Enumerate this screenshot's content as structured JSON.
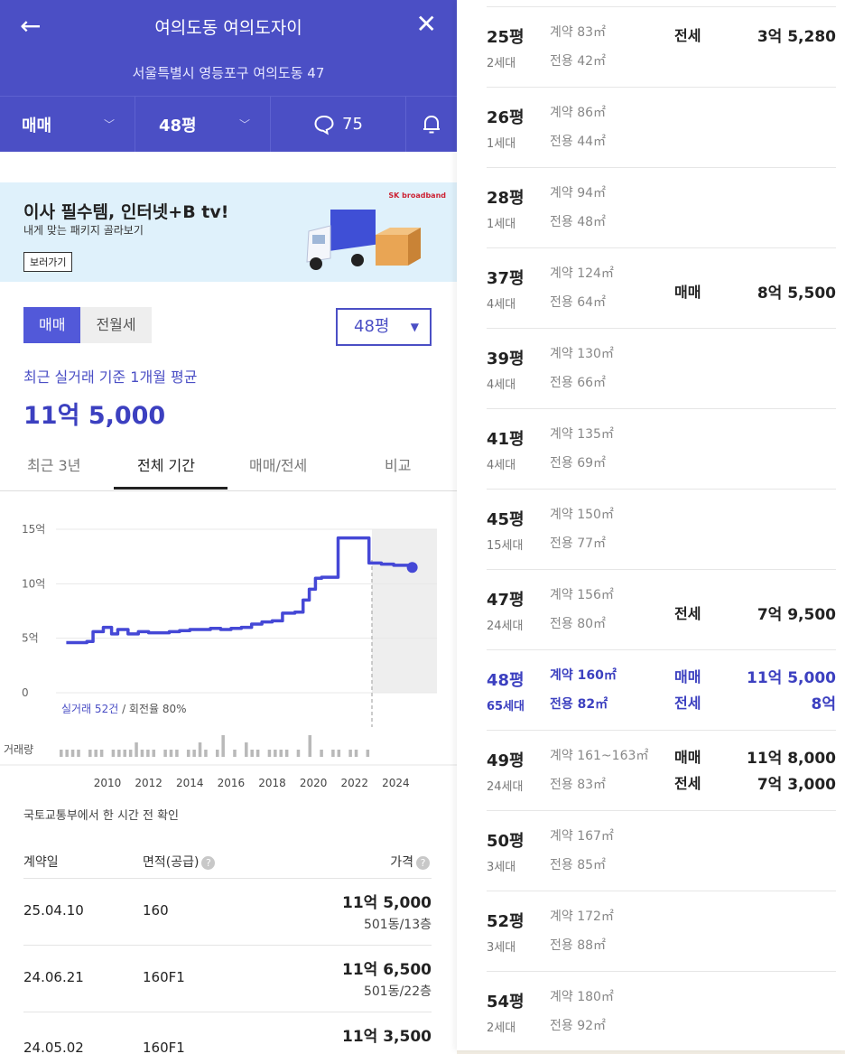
{
  "header": {
    "title": "여의도동 여의도자이",
    "address": "서울특별시 영등포구 여의도동 47",
    "deal_type": "매매",
    "size": "48평",
    "comment_count": "75"
  },
  "ad": {
    "headline": "이사 필수템, 인터넷+B tv!",
    "sub": "내게 맞는 패키지 골라보기",
    "button": "보러가기",
    "brand": "SK broadband"
  },
  "filters": {
    "seg": [
      "매매",
      "전월세"
    ],
    "size_select": "48평"
  },
  "average": {
    "label": "최근 실거래 기준 1개월 평균",
    "value": "11억 5,000"
  },
  "tabs": [
    "최근 3년",
    "전체 기간",
    "매매/전세",
    "비교"
  ],
  "chart_data": {
    "type": "line",
    "y_ticks": [
      "15억",
      "10억",
      "5억",
      "0"
    ],
    "ylim": [
      0,
      15
    ],
    "x_ticks": [
      "2010",
      "2012",
      "2014",
      "2016",
      "2018",
      "2020",
      "2022",
      "2024"
    ],
    "xlim": [
      2008,
      2026.5
    ],
    "series": [
      {
        "x": [
          2008.5,
          2009.5,
          2009.8,
          2010.3,
          2010.7,
          2011.0,
          2011.5,
          2012.0,
          2012.5,
          2013.0,
          2013.5,
          2014.0,
          2014.5,
          2015.0,
          2015.5,
          2016.0,
          2016.5,
          2017.0,
          2017.5,
          2018.0,
          2018.5,
          2019.0,
          2019.6,
          2020.0,
          2020.3,
          2020.6,
          2020.9,
          2021.2,
          2021.7,
          2022.1,
          2022.6,
          2023.2,
          2023.8,
          2024.4,
          2025.3
        ],
        "values": [
          4.6,
          4.7,
          5.6,
          6.0,
          5.4,
          5.8,
          5.4,
          5.6,
          5.5,
          5.5,
          5.6,
          5.7,
          5.8,
          5.8,
          5.9,
          5.8,
          5.9,
          6.0,
          6.3,
          6.5,
          6.6,
          7.3,
          7.4,
          8.5,
          9.5,
          10.5,
          10.6,
          10.6,
          14.2,
          14.2,
          14.2,
          11.9,
          11.8,
          11.7,
          11.5
        ]
      }
    ],
    "volume_label": "거래량",
    "volume": [
      1,
      1,
      1,
      1,
      0,
      1,
      1,
      1,
      0,
      1,
      1,
      1,
      1,
      2,
      1,
      1,
      1,
      0,
      1,
      1,
      1,
      0,
      1,
      1,
      2,
      1,
      0,
      1,
      3,
      0,
      1,
      0,
      2,
      1,
      1,
      0,
      1,
      1,
      1,
      1,
      0,
      1,
      0,
      3,
      0,
      1,
      0,
      1,
      1,
      0,
      1,
      1,
      0,
      1
    ],
    "caption_link": "실거래 52건",
    "caption_rest": " / 회전율 80%"
  },
  "source_note": "국토교통부에서 한 시간 전 확인",
  "table": {
    "headers": [
      "계약일",
      "면적(공급)",
      "가격"
    ],
    "rows": [
      {
        "date": "25.04.10",
        "area": "160",
        "price": "11억 5,000",
        "floor": "501동/13층"
      },
      {
        "date": "24.06.21",
        "area": "160F1",
        "price": "11억 6,500",
        "floor": "501동/22층"
      },
      {
        "date": "24.05.02",
        "area": "160F1",
        "price": "11억 3,500",
        "floor": ""
      }
    ]
  },
  "sizes": [
    {
      "py": "25평",
      "hh": "2세대",
      "contract": "계약 83㎡",
      "exclusive": "전용 42㎡",
      "k1": "전세",
      "v1": "3억 5,280",
      "k2": "",
      "v2": ""
    },
    {
      "py": "26평",
      "hh": "1세대",
      "contract": "계약 86㎡",
      "exclusive": "전용 44㎡",
      "k1": "",
      "v1": "",
      "k2": "",
      "v2": ""
    },
    {
      "py": "28평",
      "hh": "1세대",
      "contract": "계약 94㎡",
      "exclusive": "전용 48㎡",
      "k1": "",
      "v1": "",
      "k2": "",
      "v2": ""
    },
    {
      "py": "37평",
      "hh": "4세대",
      "contract": "계약 124㎡",
      "exclusive": "전용 64㎡",
      "k1": "매매",
      "v1": "8억 5,500",
      "k2": "",
      "v2": ""
    },
    {
      "py": "39평",
      "hh": "4세대",
      "contract": "계약 130㎡",
      "exclusive": "전용 66㎡",
      "k1": "",
      "v1": "",
      "k2": "",
      "v2": ""
    },
    {
      "py": "41평",
      "hh": "4세대",
      "contract": "계약 135㎡",
      "exclusive": "전용 69㎡",
      "k1": "",
      "v1": "",
      "k2": "",
      "v2": ""
    },
    {
      "py": "45평",
      "hh": "15세대",
      "contract": "계약 150㎡",
      "exclusive": "전용 77㎡",
      "k1": "",
      "v1": "",
      "k2": "",
      "v2": ""
    },
    {
      "py": "47평",
      "hh": "24세대",
      "contract": "계약 156㎡",
      "exclusive": "전용 80㎡",
      "k1": "전세",
      "v1": "7억 9,500",
      "k2": "",
      "v2": ""
    },
    {
      "py": "48평",
      "hh": "65세대",
      "contract": "계약 160㎡",
      "exclusive": "전용 82㎡",
      "k1": "매매",
      "v1": "11억 5,000",
      "k2": "전세",
      "v2": "8억"
    },
    {
      "py": "49평",
      "hh": "24세대",
      "contract": "계약 161~163㎡",
      "exclusive": "전용 83㎡",
      "k1": "매매",
      "v1": "11억 8,000",
      "k2": "전세",
      "v2": "7억 3,000"
    },
    {
      "py": "50평",
      "hh": "3세대",
      "contract": "계약 167㎡",
      "exclusive": "전용 85㎡",
      "k1": "",
      "v1": "",
      "k2": "",
      "v2": ""
    },
    {
      "py": "52평",
      "hh": "3세대",
      "contract": "계약 172㎡",
      "exclusive": "전용 88㎡",
      "k1": "",
      "v1": "",
      "k2": "",
      "v2": ""
    },
    {
      "py": "54평",
      "hh": "2세대",
      "contract": "계약 180㎡",
      "exclusive": "전용 92㎡",
      "k1": "",
      "v1": "",
      "k2": "",
      "v2": ""
    }
  ],
  "colors": {
    "accent": "#4b4fc5",
    "line": "#4548d6",
    "ad_bg": "#dff1fb"
  }
}
